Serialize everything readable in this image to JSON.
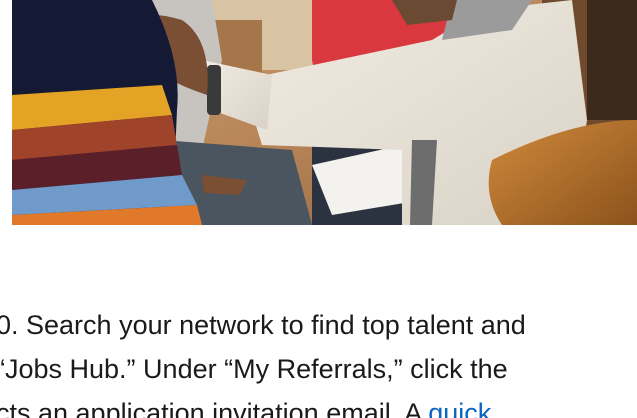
{
  "article": {
    "lines": [
      "0. Search your network to find top talent and",
      "“Jobs Hub.” Under “My Referrals,” click the"
    ],
    "line3_text": "cts an application invitation email. A ",
    "line3_link": "quick"
  },
  "colors": {
    "link": "#0a66c2",
    "text": "#1a1a1a"
  }
}
